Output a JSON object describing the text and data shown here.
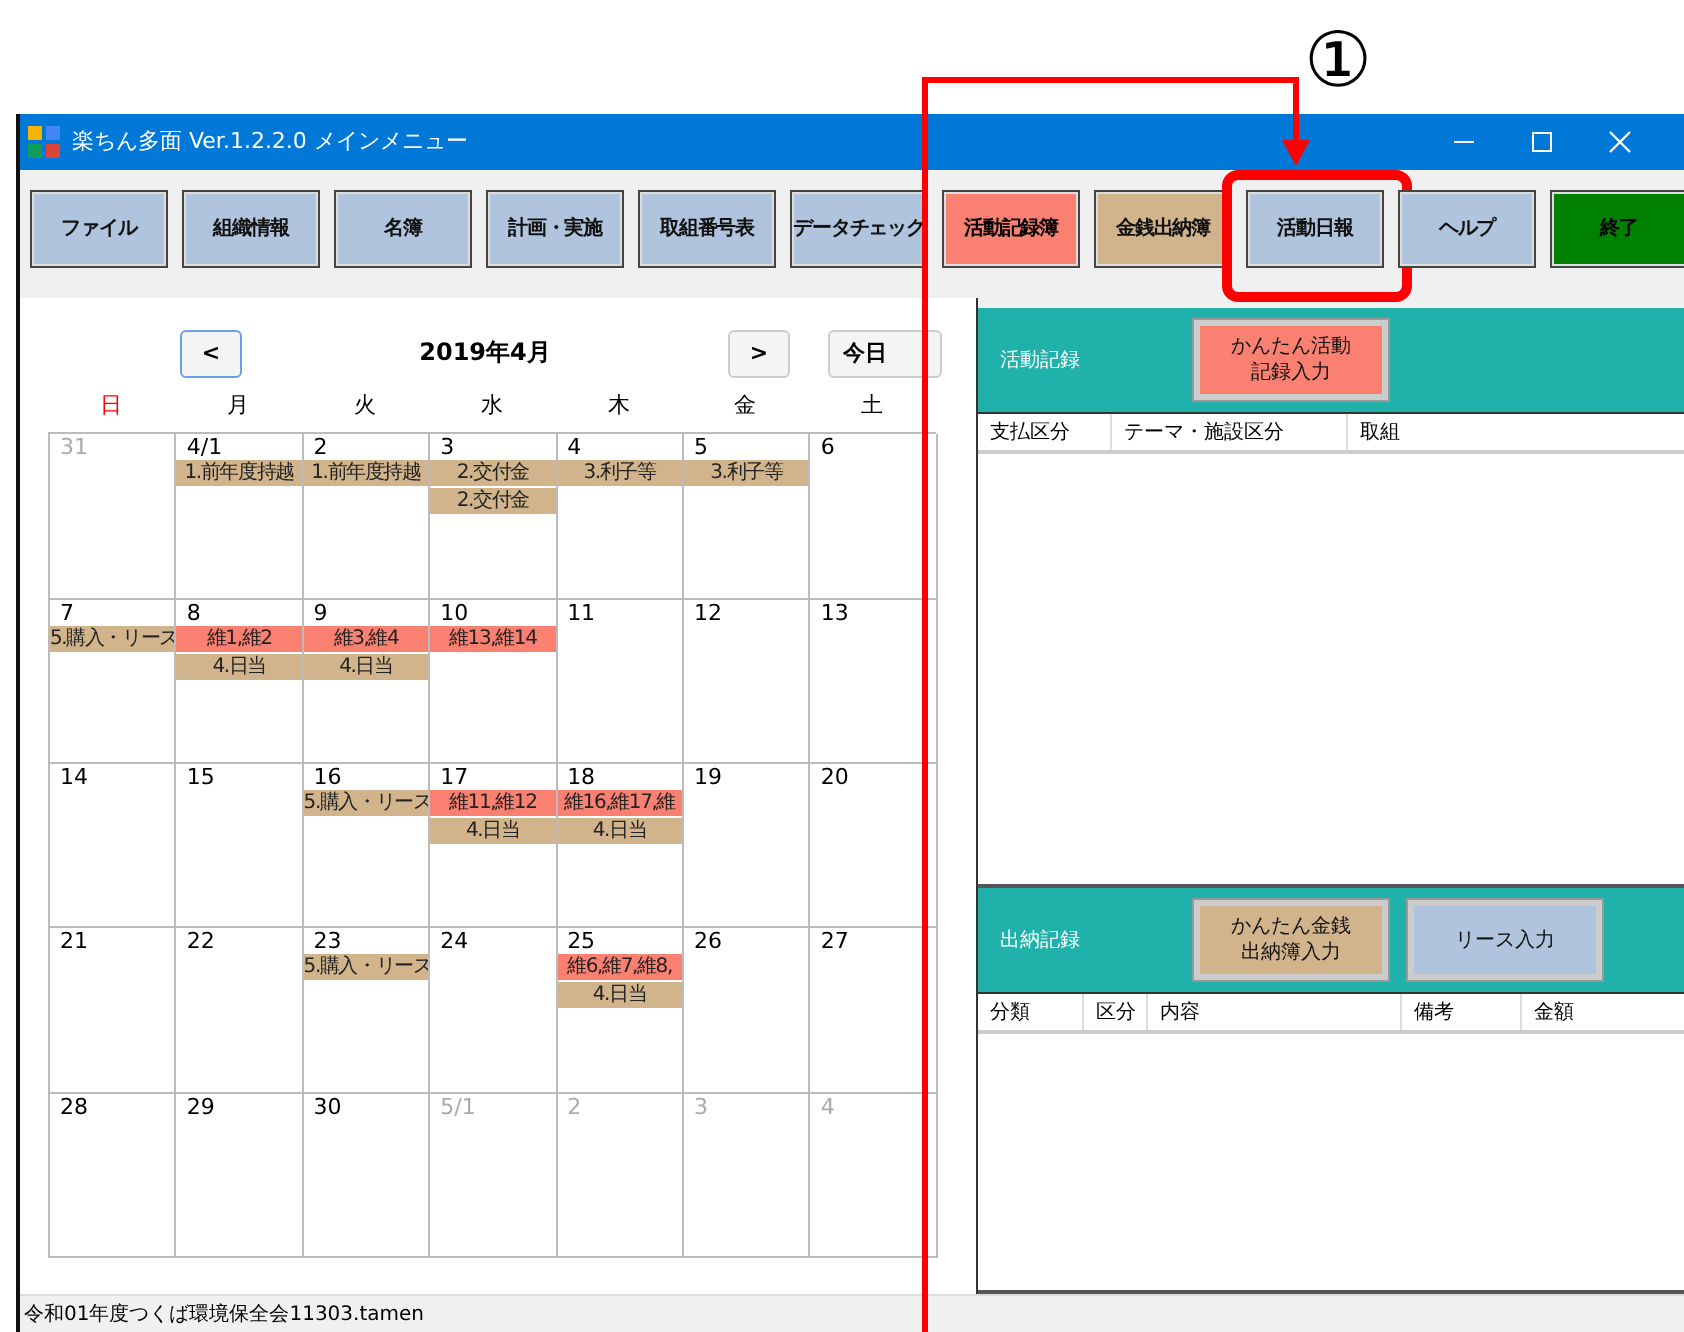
{
  "annotation": {
    "number": "①"
  },
  "window": {
    "title": "楽ちん多面 Ver.1.2.2.0 メインメニュー"
  },
  "toolbar": [
    {
      "label": "ファイル",
      "color": "#b0c4de",
      "annotated": false
    },
    {
      "label": "組織情報",
      "color": "#b0c4de",
      "annotated": false
    },
    {
      "label": "名簿",
      "color": "#b0c4de",
      "annotated": false
    },
    {
      "label": "計画・実施",
      "color": "#b0c4de",
      "annotated": false
    },
    {
      "label": "取組番号表",
      "color": "#b0c4de",
      "annotated": false
    },
    {
      "label": "データチェック",
      "color": "#b0c4de",
      "annotated": false
    },
    {
      "label": "活動記録簿",
      "color": "#fa8072",
      "annotated": false
    },
    {
      "label": "金銭出納簿",
      "color": "#d2b48c",
      "annotated": false
    },
    {
      "label": "活動日報",
      "color": "#b0c4de",
      "annotated": true
    },
    {
      "label": "ヘルプ",
      "color": "#b0c4de",
      "annotated": false
    },
    {
      "label": "終了",
      "color": "#008000",
      "annotated": false
    }
  ],
  "calendar": {
    "prev": "<",
    "title": "2019年4月",
    "next": ">",
    "today": "今日",
    "weekdays": [
      {
        "label": "日",
        "kind": "sunday"
      },
      {
        "label": "月",
        "kind": "weekday"
      },
      {
        "label": "火",
        "kind": "weekday"
      },
      {
        "label": "水",
        "kind": "weekday"
      },
      {
        "label": "木",
        "kind": "weekday"
      },
      {
        "label": "金",
        "kind": "weekday"
      },
      {
        "label": "土",
        "kind": "weekday"
      }
    ],
    "weeks": [
      [
        {
          "date": "31",
          "muted": true
        },
        {
          "date": "4/1",
          "muted": false,
          "events": [
            {
              "text": "1.前年度持越",
              "color": "#d2b48c"
            }
          ]
        },
        {
          "date": "2",
          "muted": false,
          "events": [
            {
              "text": "1.前年度持越",
              "color": "#d2b48c"
            }
          ]
        },
        {
          "date": "3",
          "muted": false,
          "events": [
            {
              "text": "2.交付金",
              "color": "#d2b48c"
            },
            {
              "text": "2.交付金",
              "color": "#d2b48c"
            }
          ]
        },
        {
          "date": "4",
          "muted": false,
          "events": [
            {
              "text": "3.利子等",
              "color": "#d2b48c"
            }
          ]
        },
        {
          "date": "5",
          "muted": false,
          "events": [
            {
              "text": "3.利子等",
              "color": "#d2b48c"
            }
          ]
        },
        {
          "date": "6",
          "muted": false
        }
      ],
      [
        {
          "date": "7",
          "muted": false,
          "events": [
            {
              "text": "5.購入・リース",
              "color": "#d2b48c"
            }
          ]
        },
        {
          "date": "8",
          "muted": false,
          "events": [
            {
              "text": "維1,維2",
              "color": "#fa8072"
            },
            {
              "text": "4.日当",
              "color": "#d2b48c"
            }
          ]
        },
        {
          "date": "9",
          "muted": false,
          "events": [
            {
              "text": "維3,維4",
              "color": "#fa8072"
            },
            {
              "text": "4.日当",
              "color": "#d2b48c"
            }
          ]
        },
        {
          "date": "10",
          "muted": false,
          "events": [
            {
              "text": "維13,維14",
              "color": "#fa8072"
            }
          ]
        },
        {
          "date": "11",
          "muted": false
        },
        {
          "date": "12",
          "muted": false
        },
        {
          "date": "13",
          "muted": false
        }
      ],
      [
        {
          "date": "14",
          "muted": false
        },
        {
          "date": "15",
          "muted": false
        },
        {
          "date": "16",
          "muted": false,
          "events": [
            {
              "text": "5.購入・リース",
              "color": "#d2b48c"
            }
          ]
        },
        {
          "date": "17",
          "muted": false,
          "events": [
            {
              "text": "維11,維12",
              "color": "#fa8072"
            },
            {
              "text": "4.日当",
              "color": "#d2b48c"
            }
          ]
        },
        {
          "date": "18",
          "muted": false,
          "events": [
            {
              "text": "維16,維17,維",
              "color": "#fa8072"
            },
            {
              "text": "4.日当",
              "color": "#d2b48c"
            }
          ]
        },
        {
          "date": "19",
          "muted": false
        },
        {
          "date": "20",
          "muted": false
        }
      ],
      [
        {
          "date": "21",
          "muted": false
        },
        {
          "date": "22",
          "muted": false
        },
        {
          "date": "23",
          "muted": false,
          "events": [
            {
              "text": "5.購入・リース",
              "color": "#d2b48c"
            }
          ]
        },
        {
          "date": "24",
          "muted": false
        },
        {
          "date": "25",
          "muted": false,
          "events": [
            {
              "text": "維6,維7,維8,",
              "color": "#fa8072"
            },
            {
              "text": "4.日当",
              "color": "#d2b48c"
            }
          ]
        },
        {
          "date": "26",
          "muted": false
        },
        {
          "date": "27",
          "muted": false
        }
      ],
      [
        {
          "date": "28",
          "muted": false
        },
        {
          "date": "29",
          "muted": false
        },
        {
          "date": "30",
          "muted": false
        },
        {
          "date": "5/1",
          "muted": true
        },
        {
          "date": "2",
          "muted": true
        },
        {
          "date": "3",
          "muted": true
        },
        {
          "date": "4",
          "muted": true
        }
      ]
    ]
  },
  "activity_panel": {
    "title": "活動記録",
    "buttons": [
      {
        "label": "かんたん活動記録入力",
        "color": "#fa8072"
      }
    ],
    "columns": [
      "支払区分",
      "テーマ・施設区分",
      "取組"
    ]
  },
  "cash_panel": {
    "title": "出納記録",
    "buttons": [
      {
        "label": "かんたん金銭出納簿入力",
        "color": "#d2b48c"
      },
      {
        "label": "リース入力",
        "color": "#b0c4de"
      }
    ],
    "columns": [
      "分類",
      "区分",
      "内容",
      "備考",
      "金額"
    ]
  },
  "status_bar": {
    "text": "令和01年度つくば環境保全会11303.tamen"
  }
}
